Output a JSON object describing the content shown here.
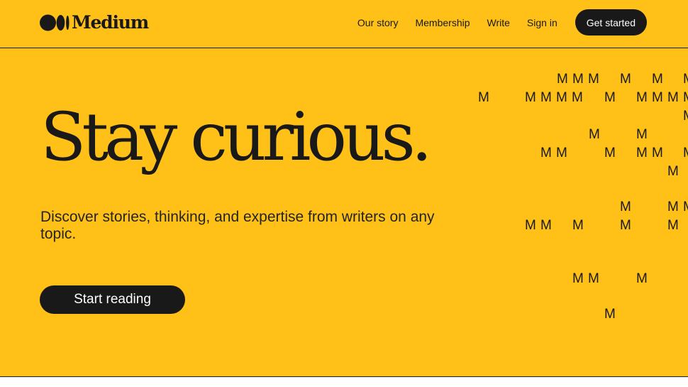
{
  "header": {
    "logo_text": "Medium",
    "nav": [
      {
        "label": "Our story"
      },
      {
        "label": "Membership"
      },
      {
        "label": "Write"
      },
      {
        "label": "Sign in"
      }
    ],
    "cta_label": "Get started"
  },
  "hero": {
    "title": "Stay curious.",
    "subtitle": "Discover stories, thinking, and expertise from writers on any topic.",
    "button_label": "Start reading",
    "pattern_glyph": "M"
  },
  "colors": {
    "background": "#FFC017",
    "ink": "#191919",
    "button_text": "#FFFFFF"
  }
}
